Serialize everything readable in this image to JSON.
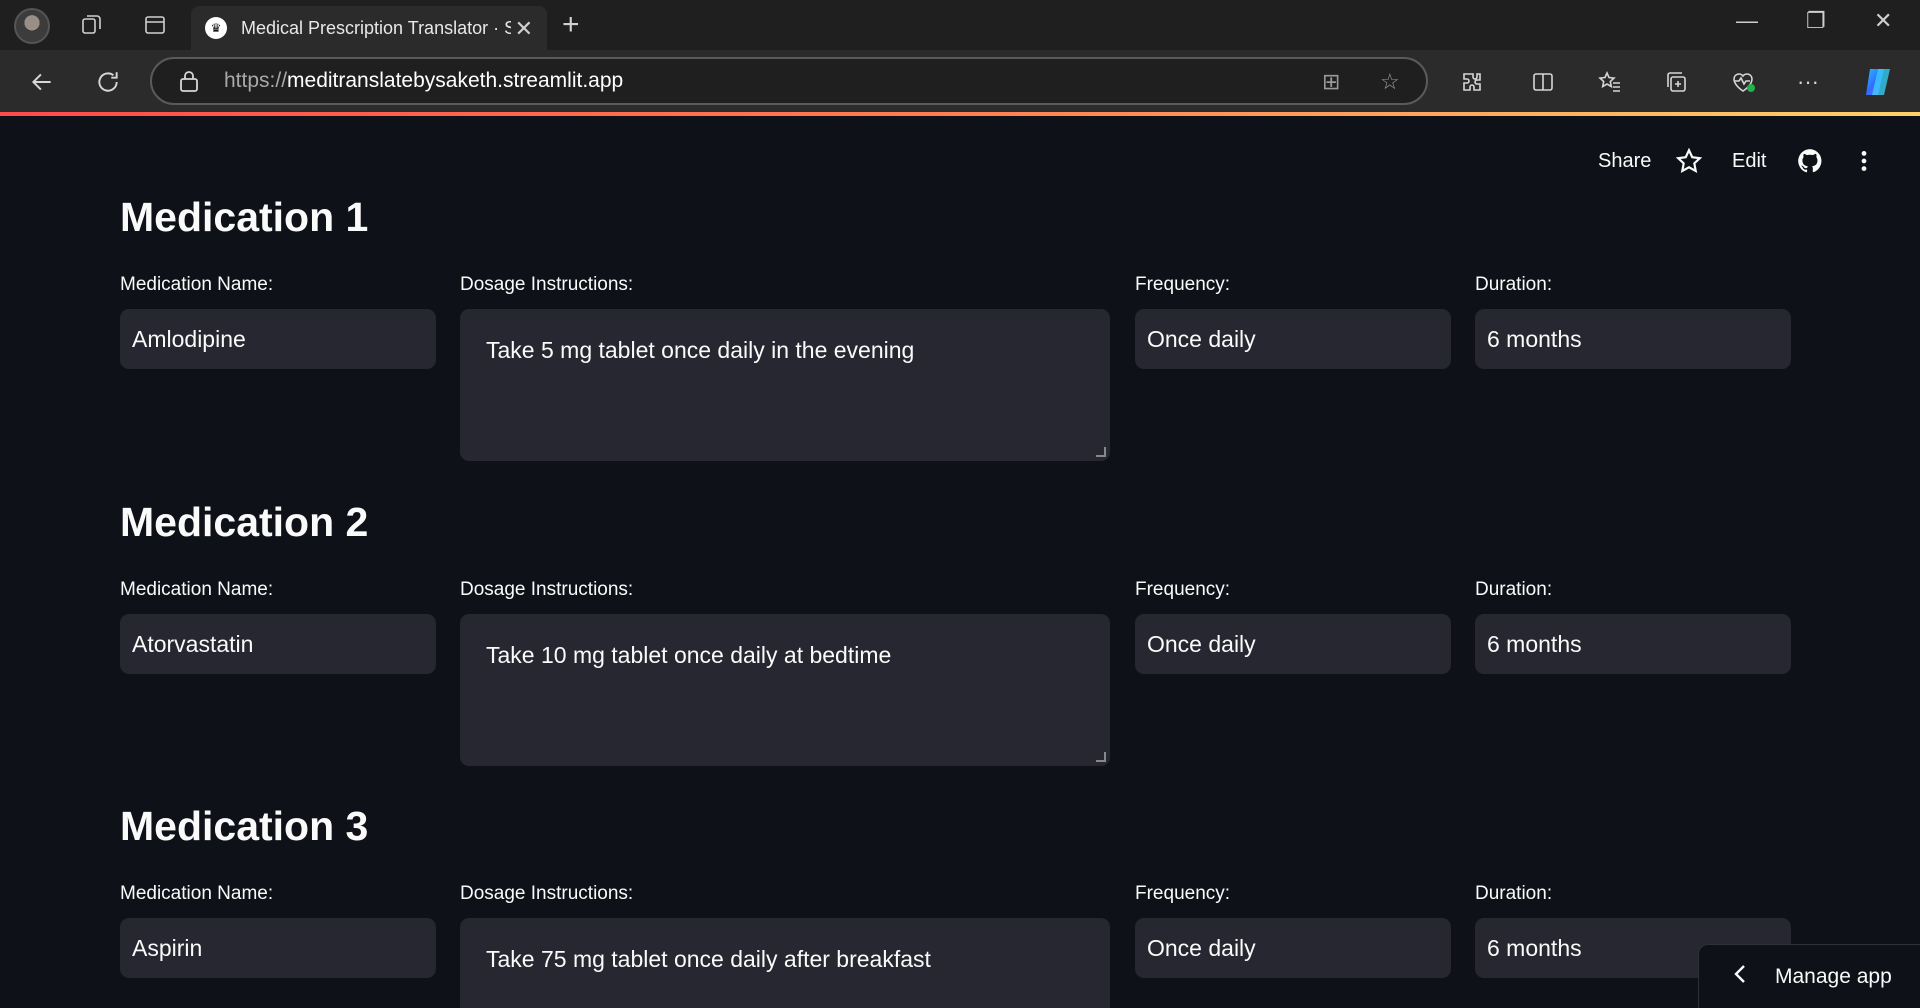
{
  "browser": {
    "tab_title": "Medical Prescription Translator · S",
    "url_scheme": "https://",
    "url_host": "meditranslatebysaketh.streamlit.app"
  },
  "header": {
    "share": "Share",
    "edit": "Edit"
  },
  "field_labels": {
    "name": "Medication Name:",
    "dosage": "Dosage Instructions:",
    "frequency": "Frequency:",
    "duration": "Duration:"
  },
  "medications": [
    {
      "heading": "Medication 1",
      "name": "Amlodipine",
      "dosage": "Take 5 mg tablet once daily in the evening",
      "frequency": "Once daily",
      "duration": "6 months"
    },
    {
      "heading": "Medication 2",
      "name": "Atorvastatin",
      "dosage": "Take 10 mg tablet once daily at bedtime",
      "frequency": "Once daily",
      "duration": "6 months"
    },
    {
      "heading": "Medication 3",
      "name": "Aspirin",
      "dosage": "Take 75 mg tablet once daily after breakfast",
      "frequency": "Once daily",
      "duration": "6 months"
    }
  ],
  "manage_app": "Manage app",
  "colors": {
    "background": "#0e1117",
    "input": "#262730",
    "accent": "#ff4b4b"
  }
}
